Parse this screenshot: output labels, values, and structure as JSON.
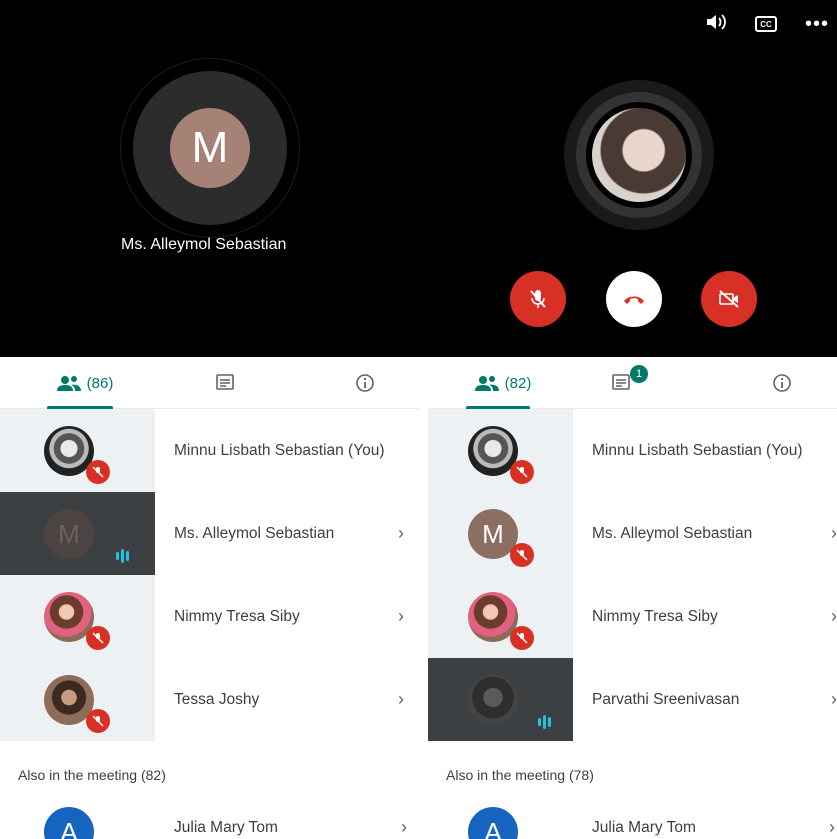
{
  "stage": {
    "icons": [
      "speaker-icon",
      "captions-icon",
      "more-icon"
    ],
    "captions_label": "CC",
    "presenter": {
      "initial": "M",
      "name": "Ms. Alleymol Sebastian"
    },
    "controls": [
      "mic-off",
      "end-call",
      "camera-off"
    ]
  },
  "colors": {
    "accent": "#00796b",
    "danger": "#d93025",
    "stage_bg": "#000000"
  },
  "left_panel": {
    "people_count": "(86)",
    "participants": [
      {
        "name": "Minnu Lisbath Sebastian (You)",
        "state": "muted"
      },
      {
        "initial": "M",
        "name": "Ms. Alleymol Sebastian",
        "state": "speaking"
      },
      {
        "name": "Nimmy Tresa Siby",
        "state": "muted"
      },
      {
        "name": "Tessa Joshy",
        "state": "muted"
      }
    ],
    "also_label": "Also in the meeting (82)",
    "next": {
      "initial": "A",
      "name": "Julia Mary Tom"
    }
  },
  "right_panel": {
    "people_count": "(82)",
    "chat_badge": "1",
    "participants": [
      {
        "name": "Minnu Lisbath Sebastian (You)",
        "state": "muted"
      },
      {
        "initial": "M",
        "name": "Ms. Alleymol Sebastian",
        "state": "muted"
      },
      {
        "name": "Nimmy Tresa Siby",
        "state": "muted"
      },
      {
        "name": "Parvathi Sreenivasan",
        "state": "speaking"
      }
    ],
    "also_label": "Also in the meeting (78)",
    "next": {
      "initial": "A",
      "name": "Julia Mary Tom"
    }
  }
}
